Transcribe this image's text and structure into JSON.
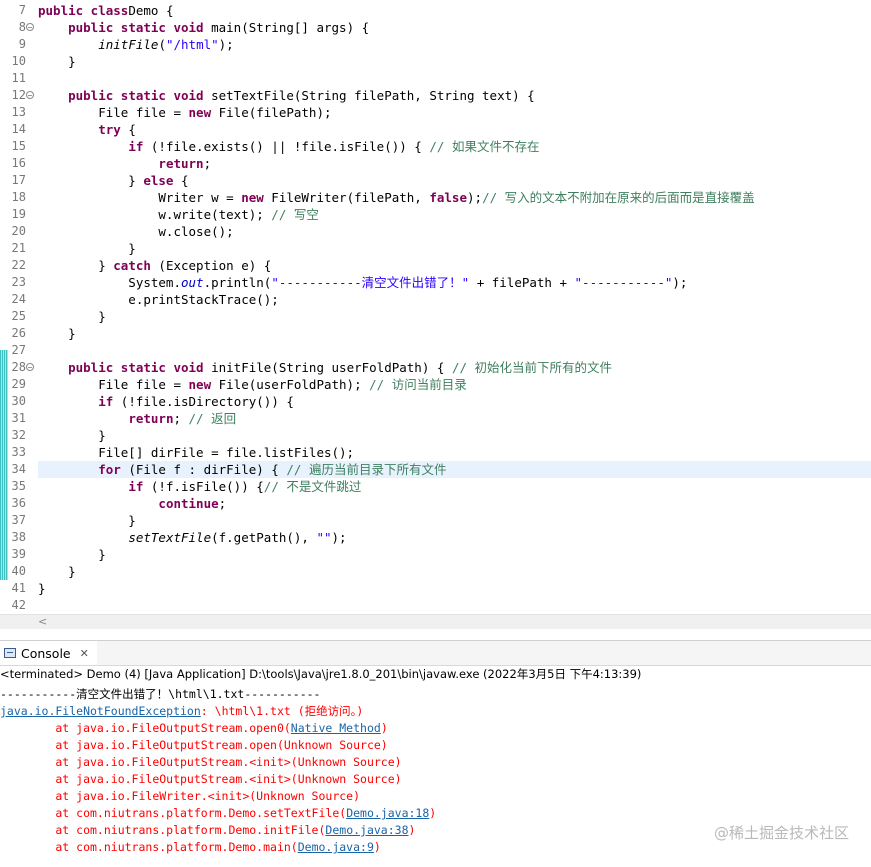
{
  "editor": {
    "lines": [
      {
        "n": "7",
        "fold": false,
        "tokens": [
          [
            "kw",
            "public class"
          ],
          [
            "",
            "Demo {"
          ]
        ]
      },
      {
        "n": "8",
        "fold": true,
        "tokens": [
          [
            "",
            "    "
          ],
          [
            "kw",
            "public static void"
          ],
          [
            "",
            " main(String[] "
          ],
          [
            "",
            "args) {"
          ]
        ]
      },
      {
        "n": "9",
        "fold": false,
        "tokens": [
          [
            "",
            "        "
          ],
          [
            "static-call",
            "initFile"
          ],
          [
            "",
            "("
          ],
          [
            "str",
            "\"/html\""
          ],
          [
            "",
            ");"
          ]
        ]
      },
      {
        "n": "10",
        "fold": false,
        "tokens": [
          [
            "",
            "    }"
          ]
        ]
      },
      {
        "n": "11",
        "fold": false,
        "tokens": []
      },
      {
        "n": "12",
        "fold": true,
        "tokens": [
          [
            "",
            "    "
          ],
          [
            "kw",
            "public static void"
          ],
          [
            "",
            " setTextFile(String filePath, String text) {"
          ]
        ]
      },
      {
        "n": "13",
        "fold": false,
        "tokens": [
          [
            "",
            "        File file = "
          ],
          [
            "kw",
            "new"
          ],
          [
            "",
            " File(filePath);"
          ]
        ]
      },
      {
        "n": "14",
        "fold": false,
        "tokens": [
          [
            "",
            "        "
          ],
          [
            "kw",
            "try"
          ],
          [
            "",
            " {"
          ]
        ]
      },
      {
        "n": "15",
        "fold": false,
        "tokens": [
          [
            "",
            "            "
          ],
          [
            "kw",
            "if"
          ],
          [
            "",
            " (!file.exists() || !file.isFile()) { "
          ],
          [
            "cmt",
            "// "
          ],
          [
            "cmt cn",
            "如果文件不存在"
          ]
        ]
      },
      {
        "n": "16",
        "fold": false,
        "tokens": [
          [
            "",
            "                "
          ],
          [
            "kw",
            "return"
          ],
          [
            "",
            ";"
          ]
        ]
      },
      {
        "n": "17",
        "fold": false,
        "tokens": [
          [
            "",
            "            } "
          ],
          [
            "kw",
            "else"
          ],
          [
            "",
            " {"
          ]
        ]
      },
      {
        "n": "18",
        "fold": false,
        "tokens": [
          [
            "",
            "                Writer w = "
          ],
          [
            "kw",
            "new"
          ],
          [
            "",
            " FileWriter(filePath, "
          ],
          [
            "kw",
            "false"
          ],
          [
            "",
            ");"
          ],
          [
            "cmt",
            "// "
          ],
          [
            "cmt cn",
            "写入的文本不附加在原来的后面而是直接覆盖"
          ]
        ]
      },
      {
        "n": "19",
        "fold": false,
        "tokens": [
          [
            "",
            "                w.write(text); "
          ],
          [
            "cmt",
            "// "
          ],
          [
            "cmt cn",
            "写空"
          ]
        ]
      },
      {
        "n": "20",
        "fold": false,
        "tokens": [
          [
            "",
            "                w.close();"
          ]
        ]
      },
      {
        "n": "21",
        "fold": false,
        "tokens": [
          [
            "",
            "            }"
          ]
        ]
      },
      {
        "n": "22",
        "fold": false,
        "tokens": [
          [
            "",
            "        } "
          ],
          [
            "kw",
            "catch"
          ],
          [
            "",
            " (Exception e) {"
          ]
        ]
      },
      {
        "n": "23",
        "fold": false,
        "tokens": [
          [
            "",
            "            System."
          ],
          [
            "field",
            "out"
          ],
          [
            "",
            ".println("
          ],
          [
            "str",
            "\"-----------"
          ],
          [
            "str cn",
            "清空文件出错了！"
          ],
          [
            "str",
            "\""
          ],
          [
            "",
            " + filePath + "
          ],
          [
            "str",
            "\"-----------\""
          ],
          [
            "",
            ");"
          ]
        ]
      },
      {
        "n": "24",
        "fold": false,
        "tokens": [
          [
            "",
            "            e.printStackTrace();"
          ]
        ]
      },
      {
        "n": "25",
        "fold": false,
        "tokens": [
          [
            "",
            "        }"
          ]
        ]
      },
      {
        "n": "26",
        "fold": false,
        "tokens": [
          [
            "",
            "    }"
          ]
        ]
      },
      {
        "n": "27",
        "fold": false,
        "tokens": []
      },
      {
        "n": "28",
        "fold": true,
        "tokens": [
          [
            "",
            "    "
          ],
          [
            "kw",
            "public static void"
          ],
          [
            "",
            " initFile(String userFoldPath) { "
          ],
          [
            "cmt",
            "// "
          ],
          [
            "cmt cn",
            "初始化当前下所有的文件"
          ]
        ]
      },
      {
        "n": "29",
        "fold": false,
        "tokens": [
          [
            "",
            "        File file = "
          ],
          [
            "kw",
            "new"
          ],
          [
            "",
            " File(userFoldPath); "
          ],
          [
            "cmt",
            "// "
          ],
          [
            "cmt cn",
            "访问当前目录"
          ]
        ]
      },
      {
        "n": "30",
        "fold": false,
        "tokens": [
          [
            "",
            "        "
          ],
          [
            "kw",
            "if"
          ],
          [
            "",
            " (!file.isDirectory()) {"
          ]
        ]
      },
      {
        "n": "31",
        "fold": false,
        "tokens": [
          [
            "",
            "            "
          ],
          [
            "kw",
            "return"
          ],
          [
            "",
            "; "
          ],
          [
            "cmt",
            "// "
          ],
          [
            "cmt cn",
            "返回"
          ]
        ]
      },
      {
        "n": "32",
        "fold": false,
        "tokens": [
          [
            "",
            "        }"
          ]
        ]
      },
      {
        "n": "33",
        "fold": false,
        "tokens": [
          [
            "",
            "        File[] dirFile = file.listFiles();"
          ]
        ]
      },
      {
        "n": "34",
        "fold": false,
        "highlight": true,
        "tokens": [
          [
            "",
            "        "
          ],
          [
            "kw",
            "for"
          ],
          [
            "",
            " (File f : dirFile) { "
          ],
          [
            "cmt",
            "// "
          ],
          [
            "cmt cn",
            "遍历当前目录下所有文件"
          ]
        ]
      },
      {
        "n": "35",
        "fold": false,
        "tokens": [
          [
            "",
            "            "
          ],
          [
            "kw",
            "if"
          ],
          [
            "",
            " (!f.isFile()) {"
          ],
          [
            "cmt",
            "// "
          ],
          [
            "cmt cn",
            "不是文件跳过"
          ]
        ]
      },
      {
        "n": "36",
        "fold": false,
        "tokens": [
          [
            "",
            "                "
          ],
          [
            "kw",
            "continue"
          ],
          [
            "",
            ";"
          ]
        ]
      },
      {
        "n": "37",
        "fold": false,
        "tokens": [
          [
            "",
            "            }"
          ]
        ]
      },
      {
        "n": "38",
        "fold": false,
        "tokens": [
          [
            "",
            "            "
          ],
          [
            "static-call",
            "setTextFile"
          ],
          [
            "",
            "(f.getPath(), "
          ],
          [
            "str",
            "\"\""
          ],
          [
            "",
            ");"
          ]
        ]
      },
      {
        "n": "39",
        "fold": false,
        "tokens": [
          [
            "",
            "        }"
          ]
        ]
      },
      {
        "n": "40",
        "fold": false,
        "tokens": [
          [
            "",
            "    }"
          ]
        ]
      },
      {
        "n": "41",
        "fold": false,
        "tokens": [
          [
            "",
            "}"
          ]
        ]
      },
      {
        "n": "42",
        "fold": false,
        "tokens": []
      }
    ]
  },
  "scrollbar": {
    "left_arrow": "<"
  },
  "console": {
    "tab_label": "Console",
    "close_glyph": "✕",
    "header": "<terminated> Demo (4) [Java Application] D:\\tools\\Java\\jre1.8.0_201\\bin\\javaw.exe (2022年3月5日 下午4:13:39)",
    "lines": [
      {
        "kind": "out",
        "parts": [
          [
            "",
            "-----------清空文件出错了！\\html\\1.txt-----------"
          ]
        ]
      },
      {
        "kind": "err",
        "parts": [
          [
            "link",
            "java.io.FileNotFoundException"
          ],
          [
            "",
            ": \\html\\1.txt (拒绝访问。)"
          ]
        ]
      },
      {
        "kind": "err",
        "parts": [
          [
            "",
            "        at java.io.FileOutputStream.open0("
          ],
          [
            "link",
            "Native Method"
          ],
          [
            "",
            ")"
          ]
        ]
      },
      {
        "kind": "err",
        "parts": [
          [
            "",
            "        at java.io.FileOutputStream.open(Unknown Source)"
          ]
        ]
      },
      {
        "kind": "err",
        "parts": [
          [
            "",
            "        at java.io.FileOutputStream.<init>(Unknown Source)"
          ]
        ]
      },
      {
        "kind": "err",
        "parts": [
          [
            "",
            "        at java.io.FileOutputStream.<init>(Unknown Source)"
          ]
        ]
      },
      {
        "kind": "err",
        "parts": [
          [
            "",
            "        at java.io.FileWriter.<init>(Unknown Source)"
          ]
        ]
      },
      {
        "kind": "err",
        "parts": [
          [
            "",
            "        at com.niutrans.platform.Demo.setTextFile("
          ],
          [
            "link",
            "Demo.java:18"
          ],
          [
            "",
            ")"
          ]
        ]
      },
      {
        "kind": "err",
        "parts": [
          [
            "",
            "        at com.niutrans.platform.Demo.initFile("
          ],
          [
            "link",
            "Demo.java:38"
          ],
          [
            "",
            ")"
          ]
        ]
      },
      {
        "kind": "err",
        "parts": [
          [
            "",
            "        at com.niutrans.platform.Demo.main("
          ],
          [
            "link",
            "Demo.java:9"
          ],
          [
            "",
            ")"
          ]
        ]
      }
    ]
  },
  "watermark": "@稀土掘金技术社区",
  "colors": {
    "keyword": "#7f0055",
    "string": "#2a00ff",
    "comment": "#3f7f5f",
    "field": "#0000c0",
    "error": "#ff0000",
    "link": "#1a64a8",
    "highlight": "#e8f2fe"
  }
}
